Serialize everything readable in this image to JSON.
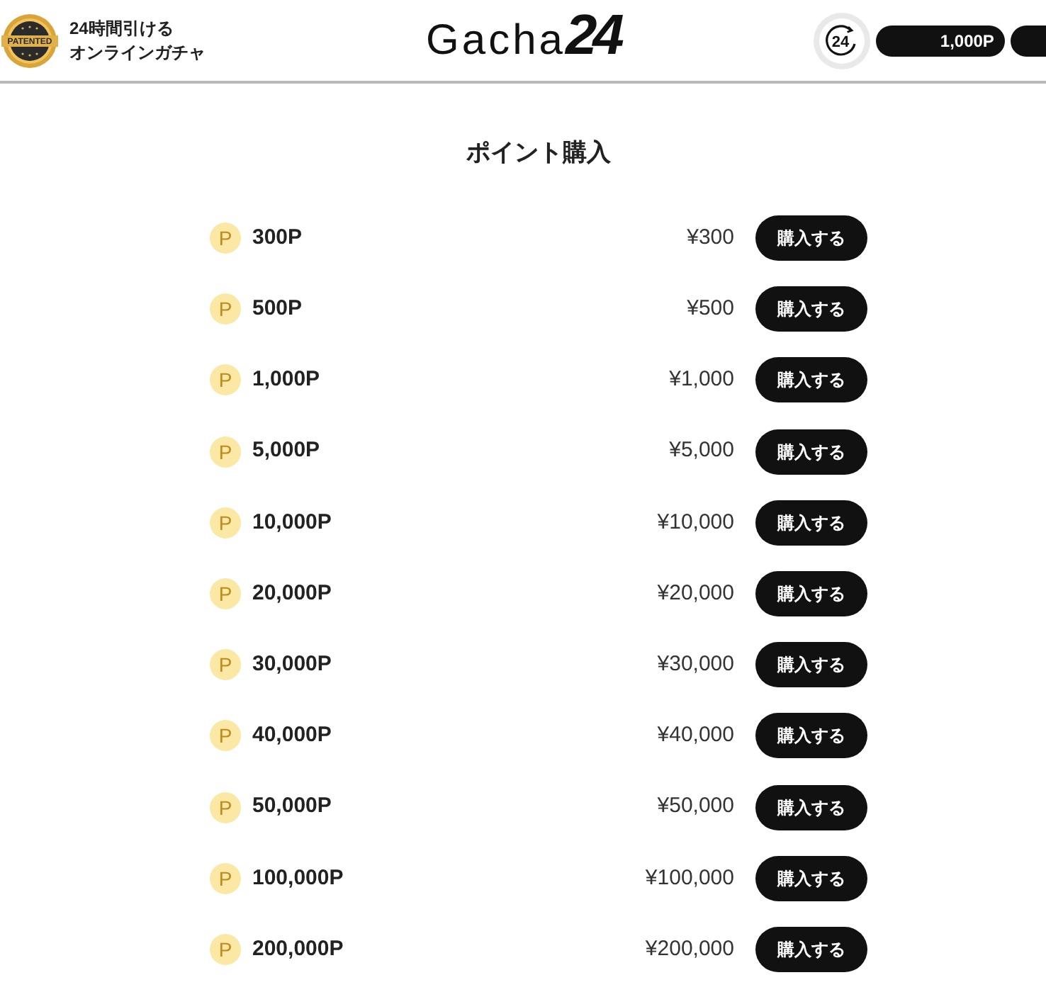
{
  "header": {
    "badge": "PATENTED",
    "tagline": [
      "24時間引ける",
      "オンラインガチャ"
    ],
    "logo": {
      "text": "Gacha",
      "number": "24"
    },
    "round_logo": "24",
    "points": "1,000P"
  },
  "title": "ポイント購入",
  "packages": [
    {
      "coin": "P",
      "points": "300P",
      "price": "¥300",
      "button": "購入する"
    },
    {
      "coin": "P",
      "points": "500P",
      "price": "¥500",
      "button": "購入する"
    },
    {
      "coin": "P",
      "points": "1,000P",
      "price": "¥1,000",
      "button": "購入する"
    },
    {
      "coin": "P",
      "points": "5,000P",
      "price": "¥5,000",
      "button": "購入する"
    },
    {
      "coin": "P",
      "points": "10,000P",
      "price": "¥10,000",
      "button": "購入する"
    },
    {
      "coin": "P",
      "points": "20,000P",
      "price": "¥20,000",
      "button": "購入する"
    },
    {
      "coin": "P",
      "points": "30,000P",
      "price": "¥30,000",
      "button": "購入する"
    },
    {
      "coin": "P",
      "points": "40,000P",
      "price": "¥40,000",
      "button": "購入する"
    },
    {
      "coin": "P",
      "points": "50,000P",
      "price": "¥50,000",
      "button": "購入する"
    },
    {
      "coin": "P",
      "points": "100,000P",
      "price": "¥100,000",
      "button": "購入する"
    },
    {
      "coin": "P",
      "points": "200,000P",
      "price": "¥200,000",
      "button": "購入する"
    }
  ]
}
